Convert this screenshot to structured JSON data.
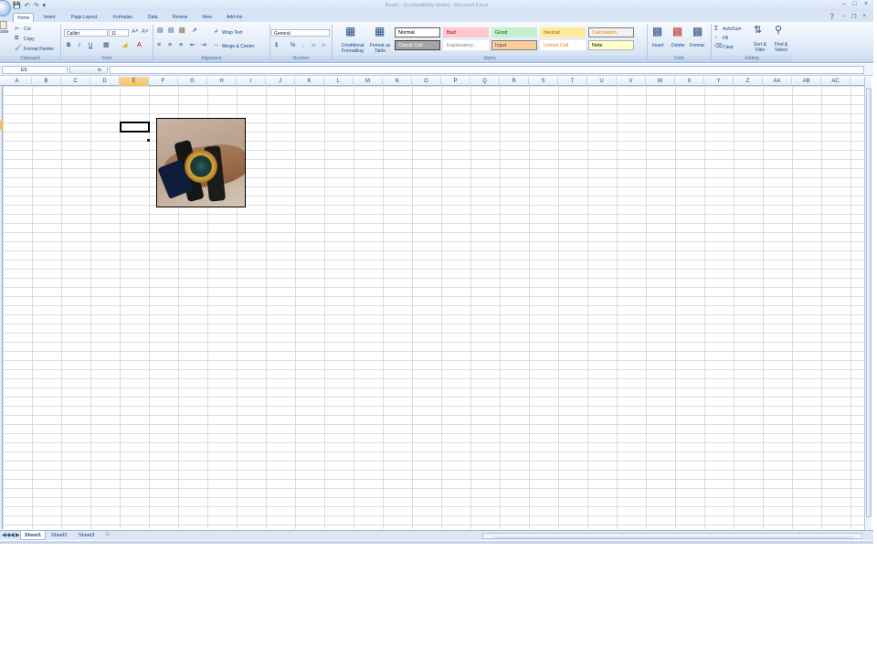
{
  "window": {
    "title": "Book1 - [Compatibility Mode] - Microsoft Excel",
    "controls": [
      "–",
      "□",
      "×"
    ]
  },
  "qat": {
    "save_icon": "save-icon",
    "undo_icon": "undo-icon",
    "redo_icon": "redo-icon"
  },
  "tabs": [
    "Home",
    "Insert",
    "Page Layout",
    "Formulas",
    "Data",
    "Review",
    "View",
    "Add-Ins"
  ],
  "ribbon": {
    "clipboard": {
      "paste": "aste",
      "cut": "Cut",
      "copy": "Copy",
      "format_painter": "Format Painter",
      "label": "Clipboard"
    },
    "font": {
      "name": "Calibri",
      "size": "11",
      "bold": "B",
      "italic": "I",
      "underline": "U",
      "label": "Font"
    },
    "alignment": {
      "wrap_text": "Wrap Text",
      "merge_center": "Merge & Center",
      "label": "Alignment"
    },
    "number": {
      "format": "General",
      "currency": "$",
      "percent": "%",
      "comma": ",",
      "label": "Number"
    },
    "conditional": {
      "conditional_formatting": "Conditional Formatting",
      "format_as_table": "Format as Table"
    },
    "styles": {
      "label": "Styles",
      "items": [
        {
          "name": "Normal",
          "bg": "#ffffff",
          "fg": "#000000",
          "border": "#5a5a5a"
        },
        {
          "name": "Bad",
          "bg": "#ffc7ce",
          "fg": "#9c0006",
          "border": "#ffc7ce"
        },
        {
          "name": "Good",
          "bg": "#c6efce",
          "fg": "#006100",
          "border": "#c6efce"
        },
        {
          "name": "Neutral",
          "bg": "#ffeb9c",
          "fg": "#9c6500",
          "border": "#ffeb9c"
        },
        {
          "name": "Calculation",
          "bg": "#f2f2f2",
          "fg": "#fa7d00",
          "border": "#7f7f7f"
        },
        {
          "name": "Check Cell",
          "bg": "#a5a5a5",
          "fg": "#ffffff",
          "border": "#3f3f3f"
        },
        {
          "name": "Explanatory...",
          "bg": "#ffffff",
          "fg": "#7f7f7f",
          "border": "#ffffff"
        },
        {
          "name": "Input",
          "bg": "#ffcc99",
          "fg": "#3f3f76",
          "border": "#7f7f7f"
        },
        {
          "name": "Linked Cell",
          "bg": "#ffffff",
          "fg": "#fa7d00",
          "border": "#ffffff"
        },
        {
          "name": "Note",
          "bg": "#ffffcc",
          "fg": "#000000",
          "border": "#b2b2b2"
        }
      ]
    },
    "cells": {
      "insert": "Insert",
      "delete": "Delete",
      "format": "Format",
      "label": "Cells"
    },
    "editing": {
      "autosum": "AutoSum",
      "fill": "Fill",
      "clear": "Clear",
      "sort_filter": "Sort & Filter",
      "find_select": "Find & Select",
      "label": "Editing"
    }
  },
  "formula_bar": {
    "name_box": "E5",
    "fx": "fx",
    "value": ""
  },
  "columns": [
    "A",
    "B",
    "C",
    "D",
    "E",
    "F",
    "G",
    "H",
    "I",
    "J",
    "K",
    "L",
    "M",
    "N",
    "O",
    "P",
    "Q",
    "R",
    "S",
    "T",
    "U",
    "V",
    "W",
    "X",
    "Y",
    "Z",
    "AA",
    "AB",
    "AC"
  ],
  "selected_column": "E",
  "sheets": [
    "Sheet1",
    "Sheet2",
    "Sheet3"
  ],
  "active_sheet": "Sheet1"
}
